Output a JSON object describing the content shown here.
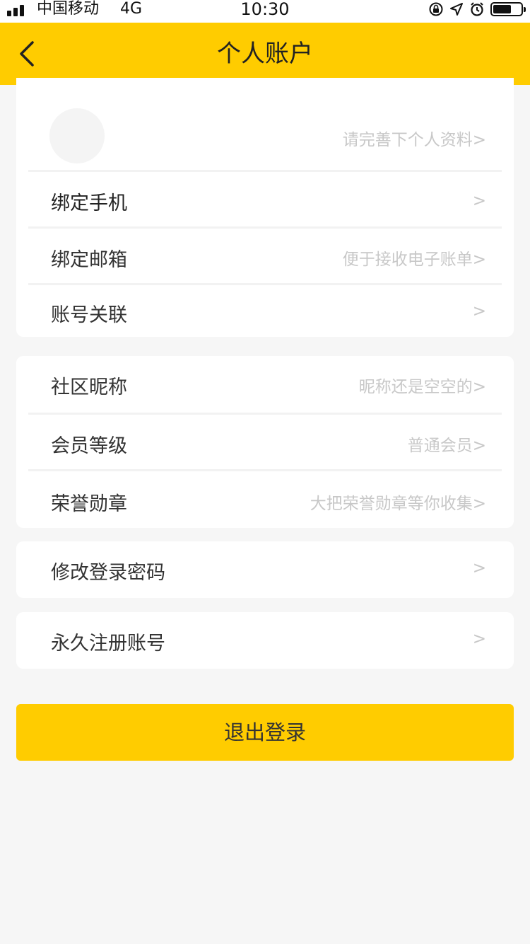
{
  "status_bar": {
    "carrier": "中国移动",
    "network": "4G",
    "time": "10:30",
    "battery_level": 0.6
  },
  "nav": {
    "title": "个人账户",
    "back_icon": "chevron-left-icon"
  },
  "profile": {
    "hint": "请完善下个人资料>"
  },
  "group1": [
    {
      "label": "绑定手机",
      "hint": ">"
    },
    {
      "label": "绑定邮箱",
      "hint": "便于接收电子账单>"
    },
    {
      "label": "账号关联",
      "hint": ">"
    }
  ],
  "group2": [
    {
      "label": "社区昵称",
      "hint": "昵称还是空空的>"
    },
    {
      "label": "会员等级",
      "hint": "普通会员>"
    },
    {
      "label": "荣誉勋章",
      "hint": "大把荣誉勋章等你收集>"
    }
  ],
  "group3": {
    "label": "修改登录密码",
    "hint": ">"
  },
  "group4": {
    "label": "永久注册账号",
    "hint": ">"
  },
  "logout": {
    "label": "退出登录"
  },
  "colors": {
    "accent": "#ffcc00",
    "background": "#f6f6f6",
    "hint_text": "#c8c8c8"
  }
}
